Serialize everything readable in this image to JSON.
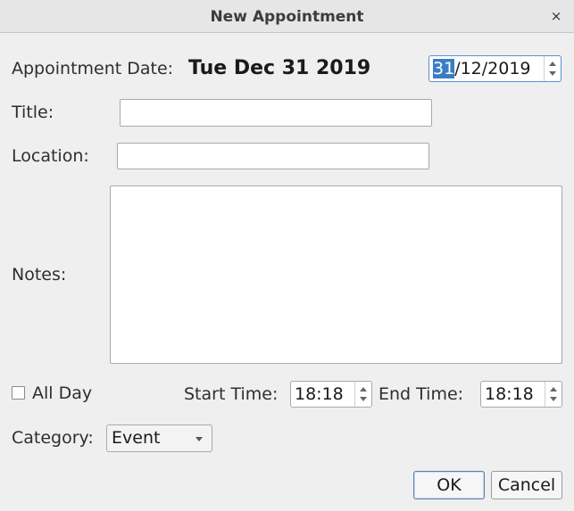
{
  "window": {
    "title": "New Appointment",
    "close_glyph": "×"
  },
  "appointment_date": {
    "label": "Appointment Date:",
    "display": "Tue Dec 31 2019",
    "spinner": {
      "day": "31",
      "rest": "/12/2019"
    }
  },
  "title_field": {
    "label": "Title:",
    "value": ""
  },
  "location_field": {
    "label": "Location:",
    "value": ""
  },
  "notes_field": {
    "label": "Notes:",
    "value": ""
  },
  "all_day": {
    "label": "All Day",
    "checked": false
  },
  "start_time": {
    "label": "Start Time:",
    "value": "18:18"
  },
  "end_time": {
    "label": "End Time:",
    "value": "18:18"
  },
  "category": {
    "label": "Category:",
    "selected": "Event"
  },
  "buttons": {
    "ok": "OK",
    "cancel": "Cancel"
  }
}
